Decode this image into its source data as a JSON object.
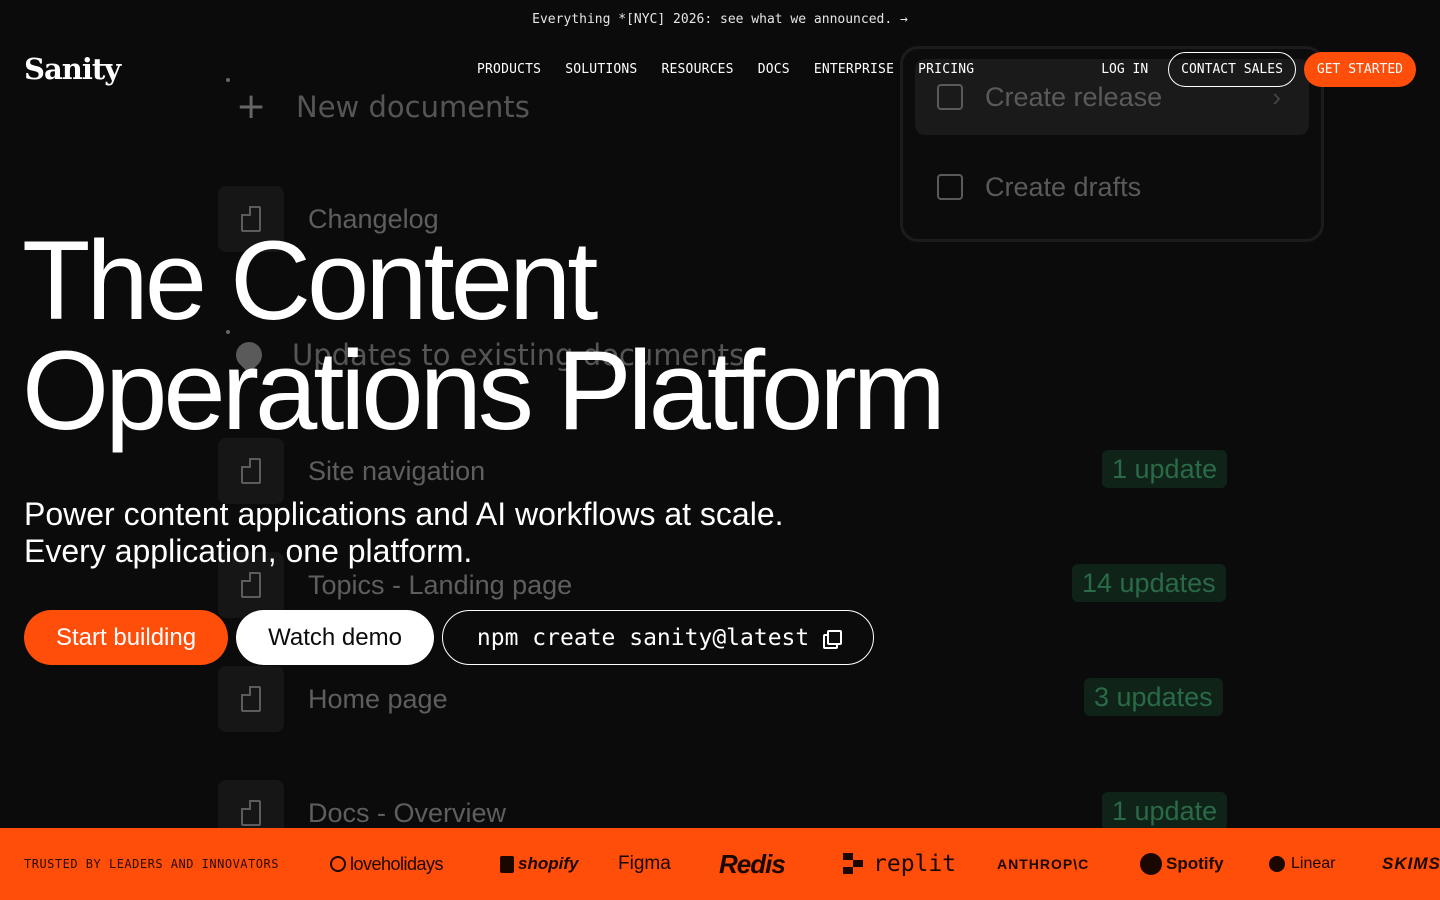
{
  "announcement": {
    "text": "Everything *[NYC] 2026: see what we announced. →"
  },
  "nav": {
    "logo": "Sanity",
    "links": [
      "PRODUCTS",
      "SOLUTIONS",
      "RESOURCES",
      "DOCS",
      "ENTERPRISE",
      "PRICING"
    ],
    "login": "LOG IN",
    "contact": "CONTACT SALES",
    "get_started": "GET STARTED"
  },
  "hero": {
    "title_line1": "The Content",
    "title_line2": "Operations Platform",
    "subtitle_line1": "Power content applications and AI workflows at scale.",
    "subtitle_line2": "Every application, one platform.",
    "start_building": "Start building",
    "watch_demo": "Watch demo",
    "npm_command": "npm create sanity@latest"
  },
  "background": {
    "new_documents": "New documents",
    "changelog": "Changelog",
    "updates_heading": "Updates to existing documents",
    "rows": [
      {
        "label": "Site navigation",
        "badge": "1 update"
      },
      {
        "label": "Topics - Landing page",
        "badge": "14 updates"
      },
      {
        "label": "Home page",
        "badge": "3 updates"
      },
      {
        "label": "Docs - Overview",
        "badge": "1 update"
      }
    ],
    "menu": {
      "create_release": "Create release",
      "create_drafts": "Create drafts"
    }
  },
  "trust": {
    "label": "TRUSTED BY LEADERS AND INNOVATORS",
    "logos": [
      "loveholidays",
      "shopify",
      "Figma",
      "Redis",
      "replit",
      "ANTHROP\\C",
      "Spotify",
      "Linear",
      "SKIMS"
    ]
  },
  "colors": {
    "accent": "#ff4d0a",
    "background": "#0b0b0b",
    "update_badge": "#0f2318"
  }
}
